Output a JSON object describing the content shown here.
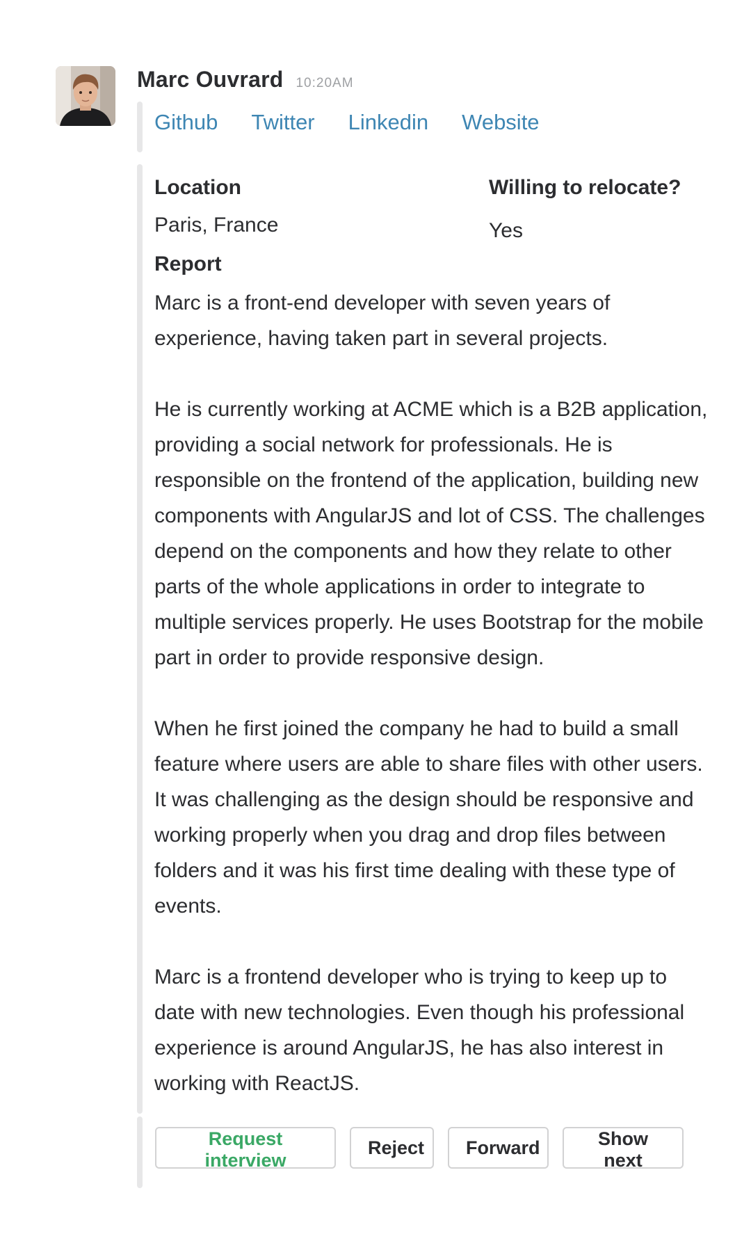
{
  "message": {
    "sender_name": "Marc Ouvrard",
    "timestamp": "10:20AM",
    "avatar_icon": "person-photo-avatar"
  },
  "links": [
    {
      "label": "Github"
    },
    {
      "label": "Twitter"
    },
    {
      "label": "Linkedin"
    },
    {
      "label": "Website"
    }
  ],
  "fields": {
    "location_title": "Location",
    "location_value": "Paris, France",
    "relocate_title": "Willing to relocate?",
    "relocate_value": "Yes",
    "report_title": "Report"
  },
  "report": {
    "paragraphs": [
      "Marc is a front-end developer with seven years of experience, having taken part in several projects.",
      "He is currently working at ACME which is a B2B application, providing a  social network for professionals. He is responsible on the frontend of the application, building new components with AngularJS and lot of CSS. The challenges depend on the components and how they relate to other parts of the whole applications in order to integrate to multiple services properly. He uses Bootstrap for the mobile part in order to provide responsive design.",
      "When he first joined the company he had to build a small feature where users are able to share files with other users. It was challenging as the design should be responsive and working properly when you drag and drop files between folders and it was his first time dealing with these type of events.",
      "Marc is a frontend developer who is trying to keep up to date with new technologies. Even though his professional experience is around AngularJS, he has also interest in working with ReactJS."
    ]
  },
  "actions": {
    "request_interview": "Request interview",
    "reject": "Reject",
    "forward": "Forward",
    "show_next": "Show next"
  },
  "colors": {
    "link": "#3e86b3",
    "primary_action": "#3aa865",
    "attachment_bar": "#e7e7e8",
    "timestamp": "#9ea0a3"
  }
}
